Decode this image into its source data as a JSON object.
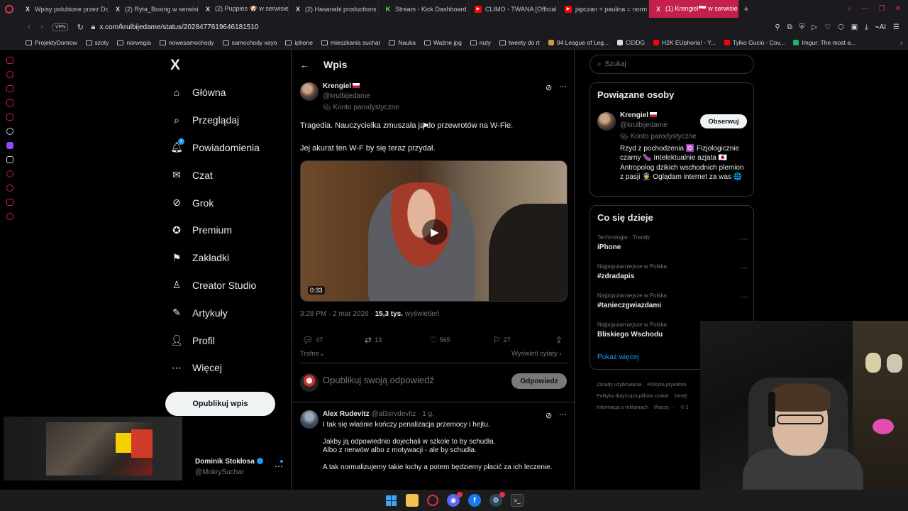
{
  "browser": {
    "tabs": [
      {
        "label": "Wpisy polubione przez Do",
        "icon": "x"
      },
      {
        "label": "(2) Ryta_Boxing w serwisi",
        "icon": "x"
      },
      {
        "label": "(2) Puppies 🐶 w serwisie",
        "icon": "x"
      },
      {
        "label": "(2) Hasanabi productions",
        "icon": "x"
      },
      {
        "label": "Stream - Kick Dashboard",
        "icon": "kick"
      },
      {
        "label": "CLIMO - TWANA [Official",
        "icon": "youtube"
      },
      {
        "label": "japczan + paulina = norm",
        "icon": "youtube"
      },
      {
        "label": "(1) Krengiel🇵🇱 w serwisie X",
        "icon": "x"
      }
    ],
    "vpn_label": "VPN",
    "url_host": "x.com",
    "url_path": "/krulbijedame/status/2028477619646181510",
    "bookmarks": [
      {
        "label": "ProjektyDomow",
        "type": "folder"
      },
      {
        "label": "szoty",
        "type": "folder"
      },
      {
        "label": "norwegia",
        "type": "folder"
      },
      {
        "label": "nowesamochody",
        "type": "folder"
      },
      {
        "label": "samochody xayo",
        "type": "folder"
      },
      {
        "label": "iphone",
        "type": "folder"
      },
      {
        "label": "mieszkania suchar",
        "type": "folder"
      },
      {
        "label": "Nauka",
        "type": "folder"
      },
      {
        "label": "Ważne jpg",
        "type": "folder"
      },
      {
        "label": "nuty",
        "type": "folder"
      },
      {
        "label": "tweety do rt",
        "type": "folder"
      },
      {
        "label": "94 League of Leg...",
        "type": "site",
        "color": "#c89b3c"
      },
      {
        "label": "CEIDG",
        "type": "site",
        "color": "#ddd"
      },
      {
        "label": "H2K EUphoria! - Y...",
        "type": "site",
        "color": "#f00"
      },
      {
        "label": "Tylko Gucio - Cov...",
        "type": "site",
        "color": "#f00"
      },
      {
        "label": "Imgur: The most a...",
        "type": "site",
        "color": "#1bb76e"
      }
    ]
  },
  "x": {
    "logo": "X",
    "nav": [
      {
        "label": "Główna",
        "icon": "home-icon",
        "glyph": "⌂"
      },
      {
        "label": "Przeglądaj",
        "icon": "search-icon",
        "glyph": "⌕"
      },
      {
        "label": "Powiadomienia",
        "icon": "bell-icon",
        "glyph": "🔔︎",
        "badge": "1"
      },
      {
        "label": "Czat",
        "icon": "mail-icon",
        "glyph": "✉"
      },
      {
        "label": "Grok",
        "icon": "grok-icon",
        "glyph": "⊘"
      },
      {
        "label": "Premium",
        "icon": "verified-icon",
        "glyph": "✪"
      },
      {
        "label": "Zakładki",
        "icon": "bookmark-icon",
        "glyph": "⚑"
      },
      {
        "label": "Creator Studio",
        "icon": "creator-icon",
        "glyph": "♙"
      },
      {
        "label": "Artykuły",
        "icon": "article-icon",
        "glyph": "✎"
      },
      {
        "label": "Profil",
        "icon": "profile-icon",
        "glyph": "👤︎"
      },
      {
        "label": "Więcej",
        "icon": "more-icon",
        "glyph": "⋯"
      }
    ],
    "post_button": "Opublikuj wpis",
    "account": {
      "name": "Dominik Stokłosa",
      "handle": "@MokrySuchar"
    }
  },
  "post": {
    "header_title": "Wpis",
    "author_name": "Krengiel",
    "author_handle": "@krulbijedame",
    "parody_label": "Konto parodystyczne",
    "text_line1": "Tragedia. Nauczycielka zmuszała ją do przewrotów na W-Fie.",
    "text_line2": "Jej akurat ten W-F by się teraz przydał.",
    "video_duration": "0:33",
    "timestamp": "3:28 PM · 2 mar 2026 · ",
    "views_count": "15,3 tys.",
    "views_label": " wyświetleń",
    "replies": "47",
    "reposts": "13",
    "likes": "565",
    "bookmarks": "27",
    "sort_label": "Trafne",
    "quotes_label": "Wyświetl cytaty",
    "reply_placeholder": "Opublikuj swoją odpowiedź",
    "reply_button": "Odpowiedz"
  },
  "reply": {
    "name": "Alex Rudevitz",
    "handle_time": "@al3xrvdevitz · 1 g.",
    "lines": [
      "I tak się właśnie kończy penalizacja przemocy i hejtu.",
      "Jakby ją odpowiednio dojechali w szkole to by schudła.",
      "Albo z nerwów albo z motywacji - ale by schudła.",
      "A tak normalizujemy takie lochy a potem będziemy płacić za ich leczenie."
    ]
  },
  "sidebar": {
    "search_placeholder": "Szukaj",
    "related_title": "Powiązane osoby",
    "related": {
      "name": "Krengiel",
      "handle": "@krulbijedame",
      "parody": "Konto parodystyczne",
      "follow_label": "Obserwuj",
      "bio": "Rzyd z pochodzenia 🔯 Fizjologicznie czarny 🍆 Intelektualnie azjata 🇯🇵 Antropolog dzikich wschodnich plemion z pasji 👮 Oglądam internet za was 🌐"
    },
    "trends_title": "Co się dzieje",
    "trends": [
      {
        "category": "Technologie · Trendy",
        "name": "iPhone"
      },
      {
        "category": "Najpopularniejsze w Polska",
        "name": "#zdradapis"
      },
      {
        "category": "Najpopularniejsze w Polska",
        "name": "#tanieczgwiazdami"
      },
      {
        "category": "Najpopularniejsze w Polska",
        "name": "Bliskiego Wschodu"
      }
    ],
    "show_more": "Pokaż więcej",
    "footer": [
      "Zasady użytkowania",
      "Polityka prywatno",
      "Polityka dotycząca plików cookie",
      "Dostę",
      "Informacja o reklamach",
      "Więcej ···",
      "© 2"
    ]
  },
  "colors": {
    "accent": "#1d9bf0",
    "opera": "#e0334a",
    "active_tab": "#c3214b"
  }
}
